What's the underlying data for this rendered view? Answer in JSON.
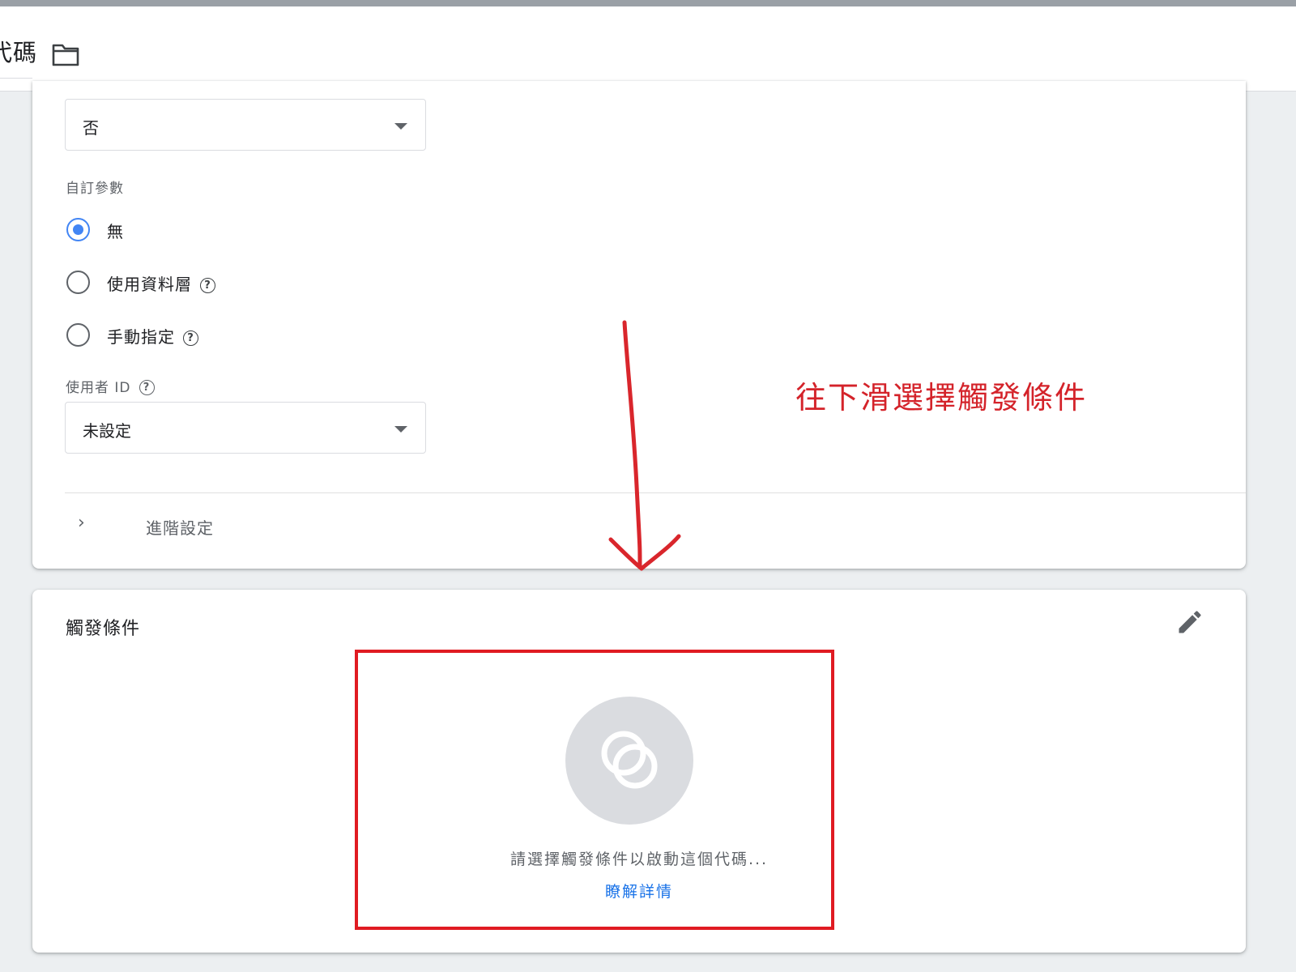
{
  "header": {
    "title": "代碼",
    "folder_icon": "folder-icon"
  },
  "tag_config": {
    "top_select_value": "否",
    "custom_params_label": "自訂參數",
    "radio_options": [
      {
        "label": "無",
        "checked": true
      },
      {
        "label": "使用資料層",
        "checked": false,
        "help": "?"
      },
      {
        "label": "手動指定",
        "checked": false,
        "help": "?"
      }
    ],
    "user_id_label": "使用者 ID",
    "user_id_help": "?",
    "user_id_value": "未設定",
    "advanced_label": "進階設定",
    "advanced_chevron": "›"
  },
  "triggers": {
    "title": "觸發條件",
    "empty_text": "請選擇觸發條件以啟動這個代碼...",
    "learn_more": "瞭解詳情"
  },
  "annotation": {
    "text": "往下滑選擇觸發條件",
    "color": "#d4232a"
  },
  "colors": {
    "accent": "#4285f4",
    "link": "#1a73e8",
    "highlight_box": "#e01b22"
  }
}
